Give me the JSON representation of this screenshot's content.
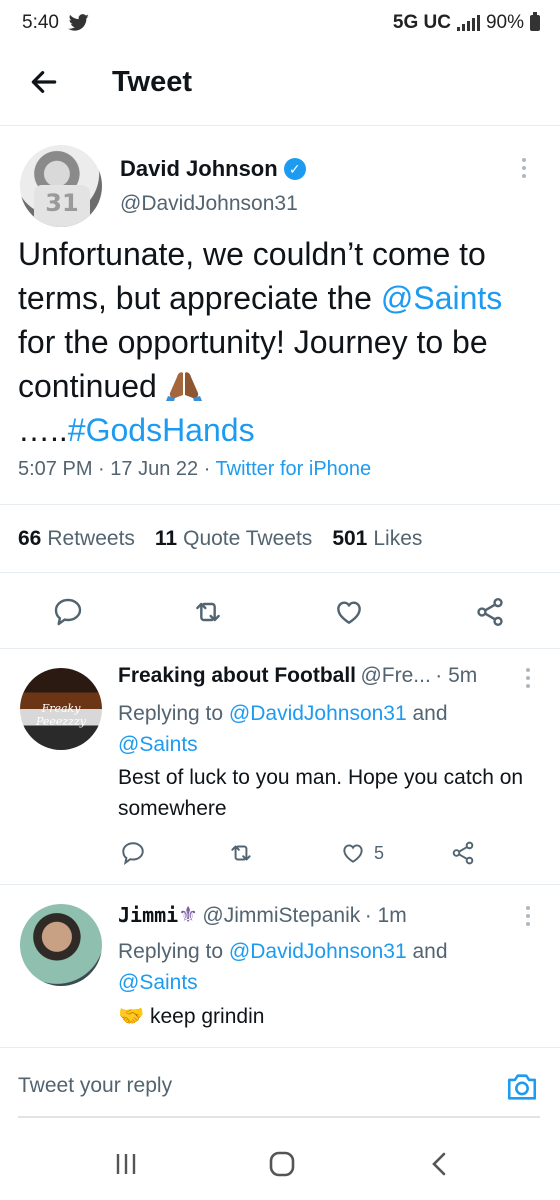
{
  "status_bar": {
    "time": "5:40",
    "network": "5G UC",
    "battery": "90%"
  },
  "header": {
    "title": "Tweet"
  },
  "tweet": {
    "author_name": "David Johnson",
    "author_handle": "@DavidJohnson31",
    "avatar_jersey": "31",
    "text_line1": "Unfortunate, we couldn’t come to terms, but appreciate the ",
    "mention": "@Saints",
    "text_line2": " for the opportunity! Journey to be continued ",
    "ellipsis": "…..",
    "hashtag": "#GodsHands",
    "time": "5:07 PM",
    "date": "17 Jun 22",
    "source": "Twitter for iPhone",
    "retweets_count": "66",
    "retweets_label": "Retweets",
    "quotes_count": "11",
    "quotes_label": "Quote Tweets",
    "likes_count": "501",
    "likes_label": "Likes"
  },
  "replies": [
    {
      "name": "Freaking about Football",
      "handle": "@Fre...",
      "time": "· 5m",
      "avatar_text": "Freaky Peeezzzy",
      "replying_prefix": "Replying to ",
      "replying_to_1": "@DavidJohnson31",
      "replying_and": " and",
      "replying_to_2": "@Saints",
      "text": "Best of luck to you man. Hope you catch on somewhere",
      "likes": "5"
    },
    {
      "name": "Jimmi",
      "name_emoji": "⚜",
      "handle": "@JimmiStepanik",
      "time": "· 1m",
      "replying_prefix": "Replying to ",
      "replying_to_1": "@DavidJohnson31",
      "replying_and": " and",
      "replying_to_2": "@Saints",
      "text_emoji": "🤝",
      "text": "keep grindin"
    }
  ],
  "composer": {
    "placeholder": "Tweet your reply"
  },
  "icons": [
    "back-arrow-icon",
    "verified-badge-icon",
    "more-icon",
    "reply-icon",
    "retweet-icon",
    "like-icon",
    "share-icon",
    "camera-icon",
    "recents-icon",
    "home-icon",
    "nav-back-icon"
  ],
  "colors": {
    "accent": "#1d9bf0",
    "text": "#0f1419",
    "secondary": "#536471"
  }
}
